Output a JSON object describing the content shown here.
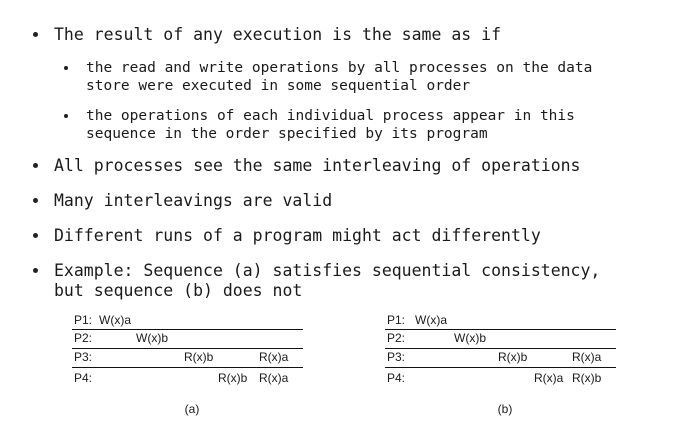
{
  "bullets": {
    "b1": "The result of any execution is the same as if",
    "b1_sub1_l1": "the read and write operations by all processes on the data",
    "b1_sub1_l2": "store were executed in some sequential order",
    "b1_sub2_l1": "the operations of each individual process appear in this",
    "b1_sub2_l2": "sequence in the order specified by its program",
    "b2": "All processes see the same interleaving of operations",
    "b3": "Many interleavings are valid",
    "b4": "Different runs of a program might act differently",
    "b5_l1": "Example: Sequence (a) satisfies sequential consistency,",
    "b5_l2": "but sequence (b) does not"
  },
  "sequence_a": {
    "caption": "(a)",
    "rows": [
      {
        "process": "P1:",
        "ops": [
          "W(x)a"
        ]
      },
      {
        "process": "P2:",
        "ops": [
          "W(x)b"
        ]
      },
      {
        "process": "P3:",
        "ops": [
          "R(x)b",
          "R(x)a"
        ]
      },
      {
        "process": "P4:",
        "ops": [
          "R(x)b",
          "R(x)a"
        ]
      }
    ]
  },
  "sequence_b": {
    "caption": "(b)",
    "rows": [
      {
        "process": "P1:",
        "ops": [
          "W(x)a"
        ]
      },
      {
        "process": "P2:",
        "ops": [
          "W(x)b"
        ]
      },
      {
        "process": "P3:",
        "ops": [
          "R(x)b",
          "R(x)a"
        ]
      },
      {
        "process": "P4:",
        "ops": [
          "R(x)a",
          "R(x)b"
        ]
      }
    ]
  }
}
